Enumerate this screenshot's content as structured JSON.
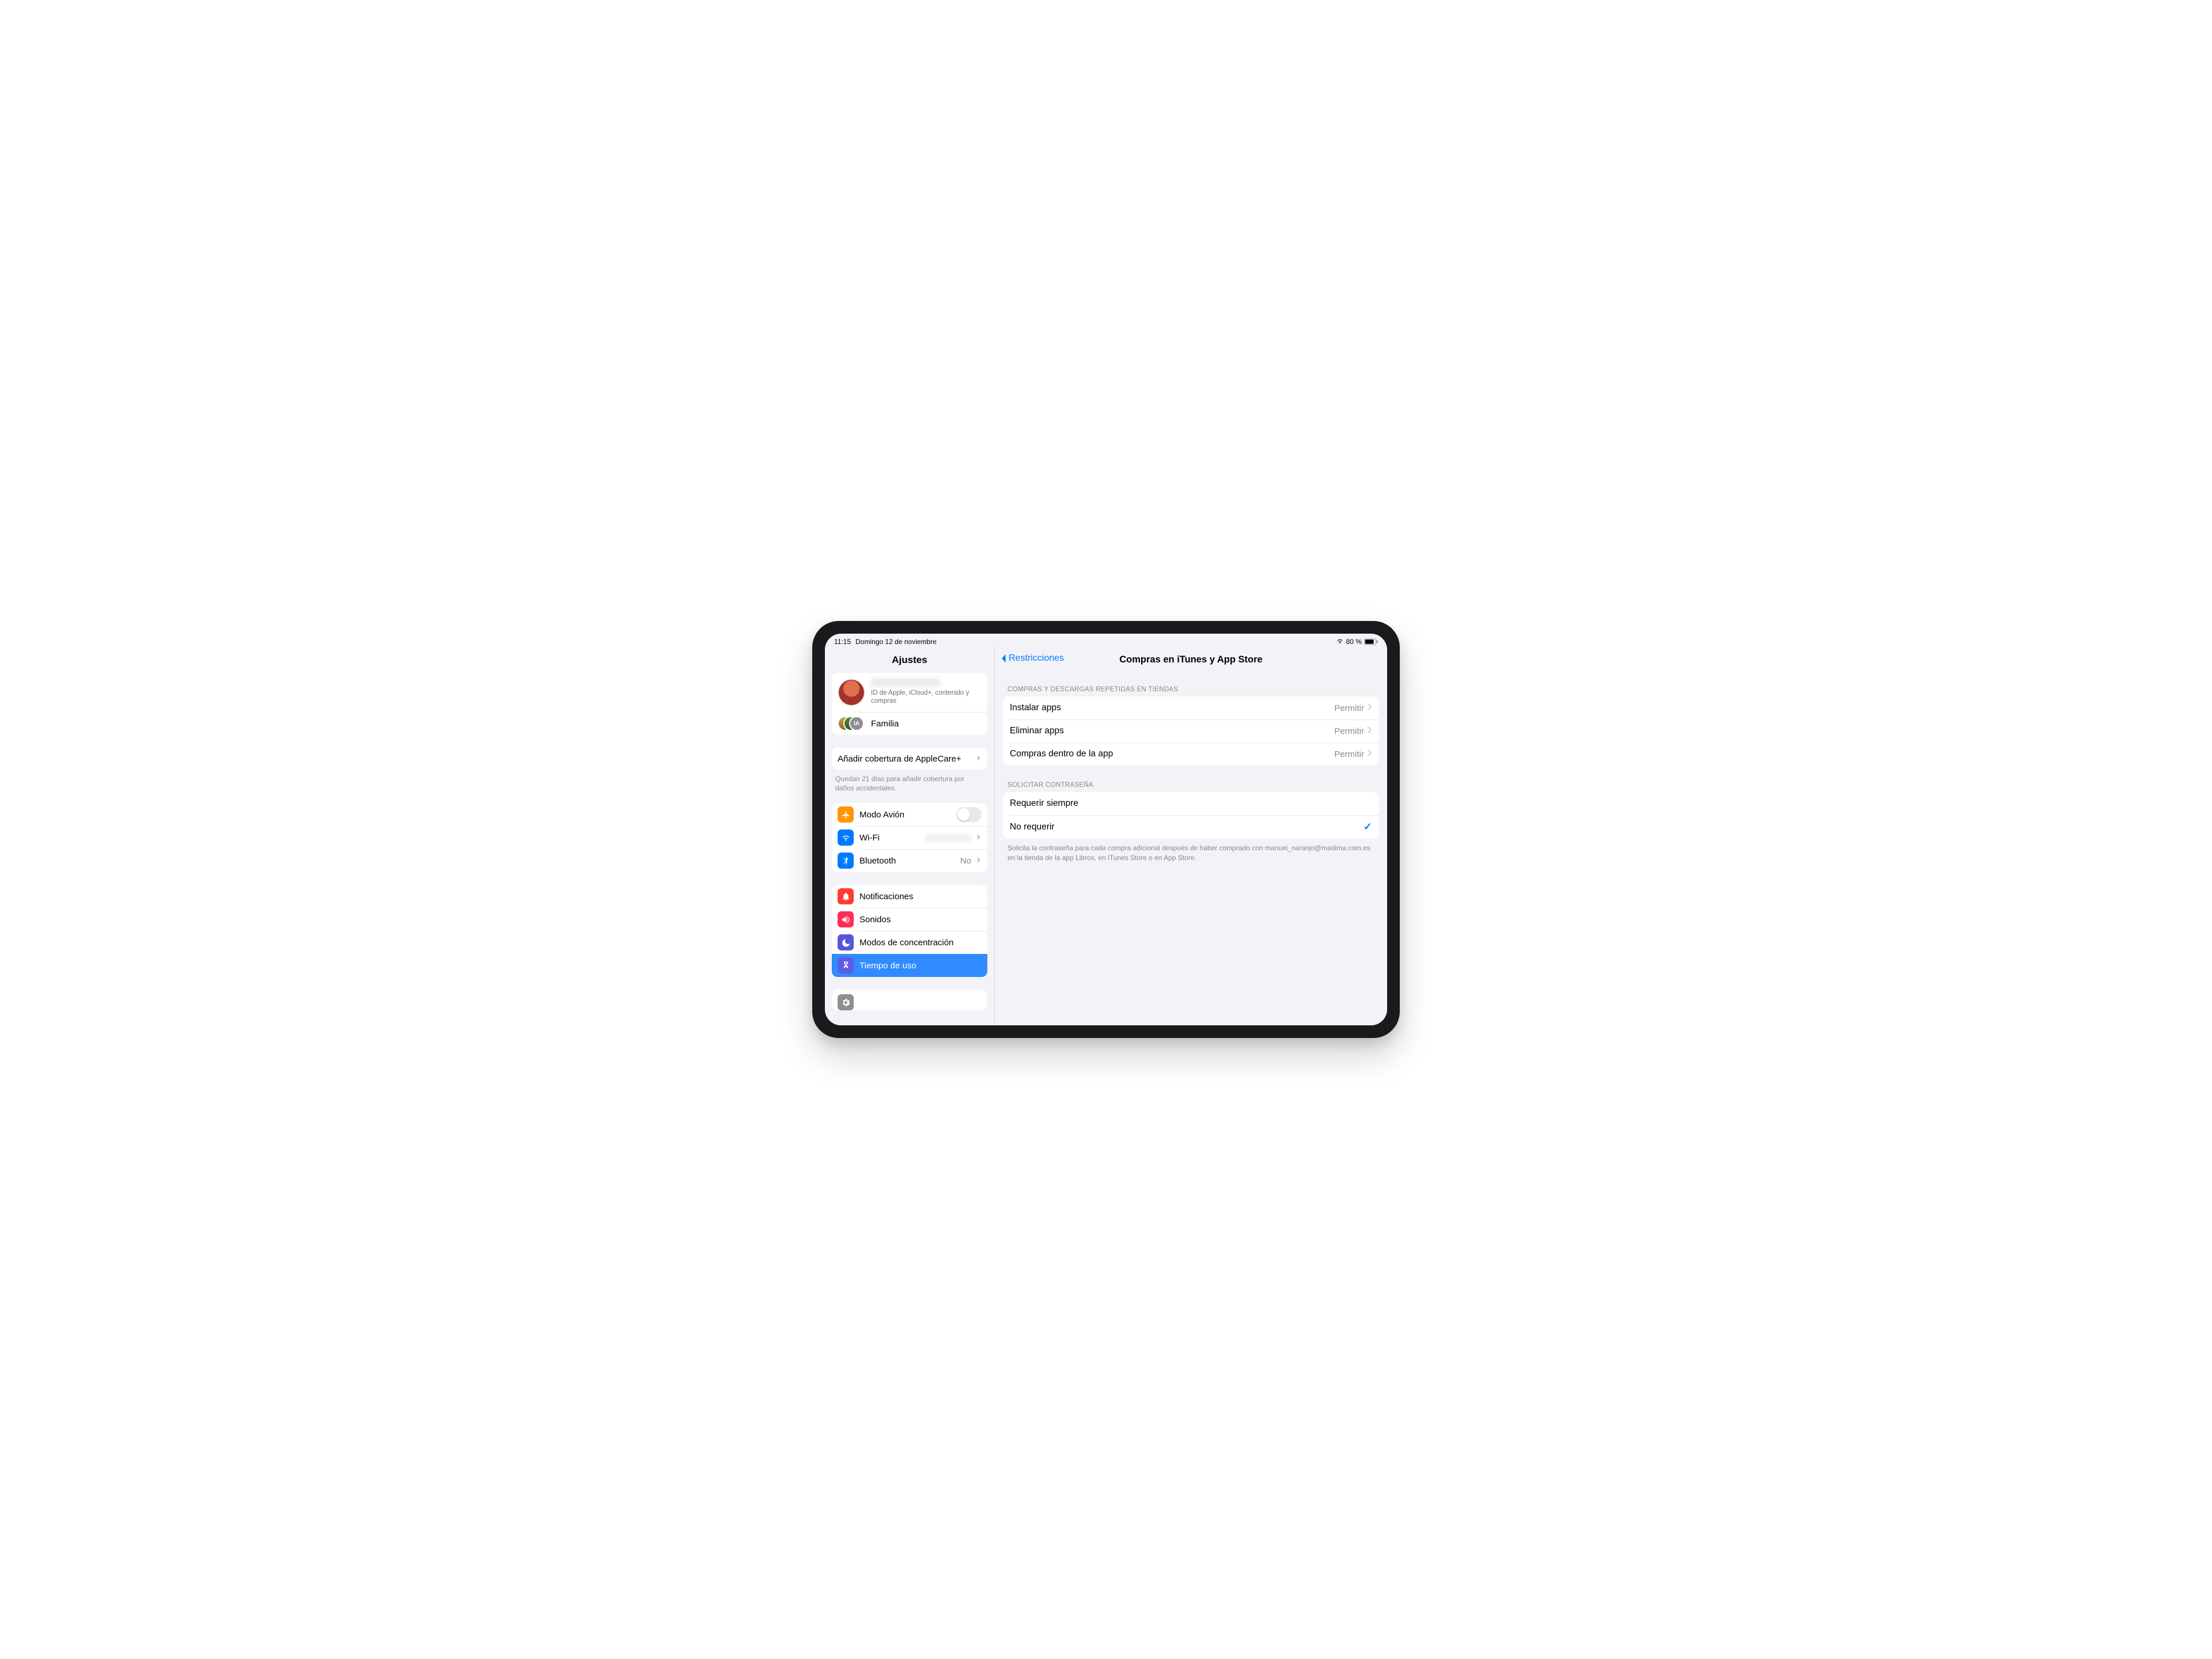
{
  "statusbar": {
    "time": "11:15",
    "date": "Domingo 12 de noviembre",
    "battery_pct": "80 %"
  },
  "sidebar": {
    "title": "Ajustes",
    "account": {
      "subtitle": "ID de Apple, iCloud+, contenido y compras"
    },
    "family": {
      "label": "Familia",
      "initials": "IA"
    },
    "applecare": {
      "label": "Añadir cobertura de AppleCare+",
      "note": "Quedan 21 días para añadir cobertura por daños accidentales."
    },
    "airplane": {
      "label": "Modo Avión"
    },
    "wifi": {
      "label": "Wi-Fi",
      "value": ""
    },
    "bluetooth": {
      "label": "Bluetooth",
      "value": "No"
    },
    "notifications": {
      "label": "Notificaciones"
    },
    "sounds": {
      "label": "Sonidos"
    },
    "focus": {
      "label": "Modos de concentración"
    },
    "screentime": {
      "label": "Tiempo de uso"
    }
  },
  "detail": {
    "back_label": "Restricciones",
    "title": "Compras en iTunes y App Store",
    "section1_header": "COMPRAS Y DESCARGAS REPETIDAS EN TIENDAS",
    "rows1": {
      "install": {
        "label": "Instalar apps",
        "value": "Permitir"
      },
      "delete": {
        "label": "Eliminar apps",
        "value": "Permitir"
      },
      "inapp": {
        "label": "Compras dentro de la app",
        "value": "Permitir"
      }
    },
    "section2_header": "SOLICITAR CONTRASEÑA",
    "rows2": {
      "always": {
        "label": "Requerir siempre"
      },
      "never": {
        "label": "No requerir"
      }
    },
    "footer": "Solicita la contraseña para cada compra adicional después de haber comprado con manuel_naranjo@madima.com.es en la tienda de la app Libros, en iTunes Store o en App Store."
  }
}
